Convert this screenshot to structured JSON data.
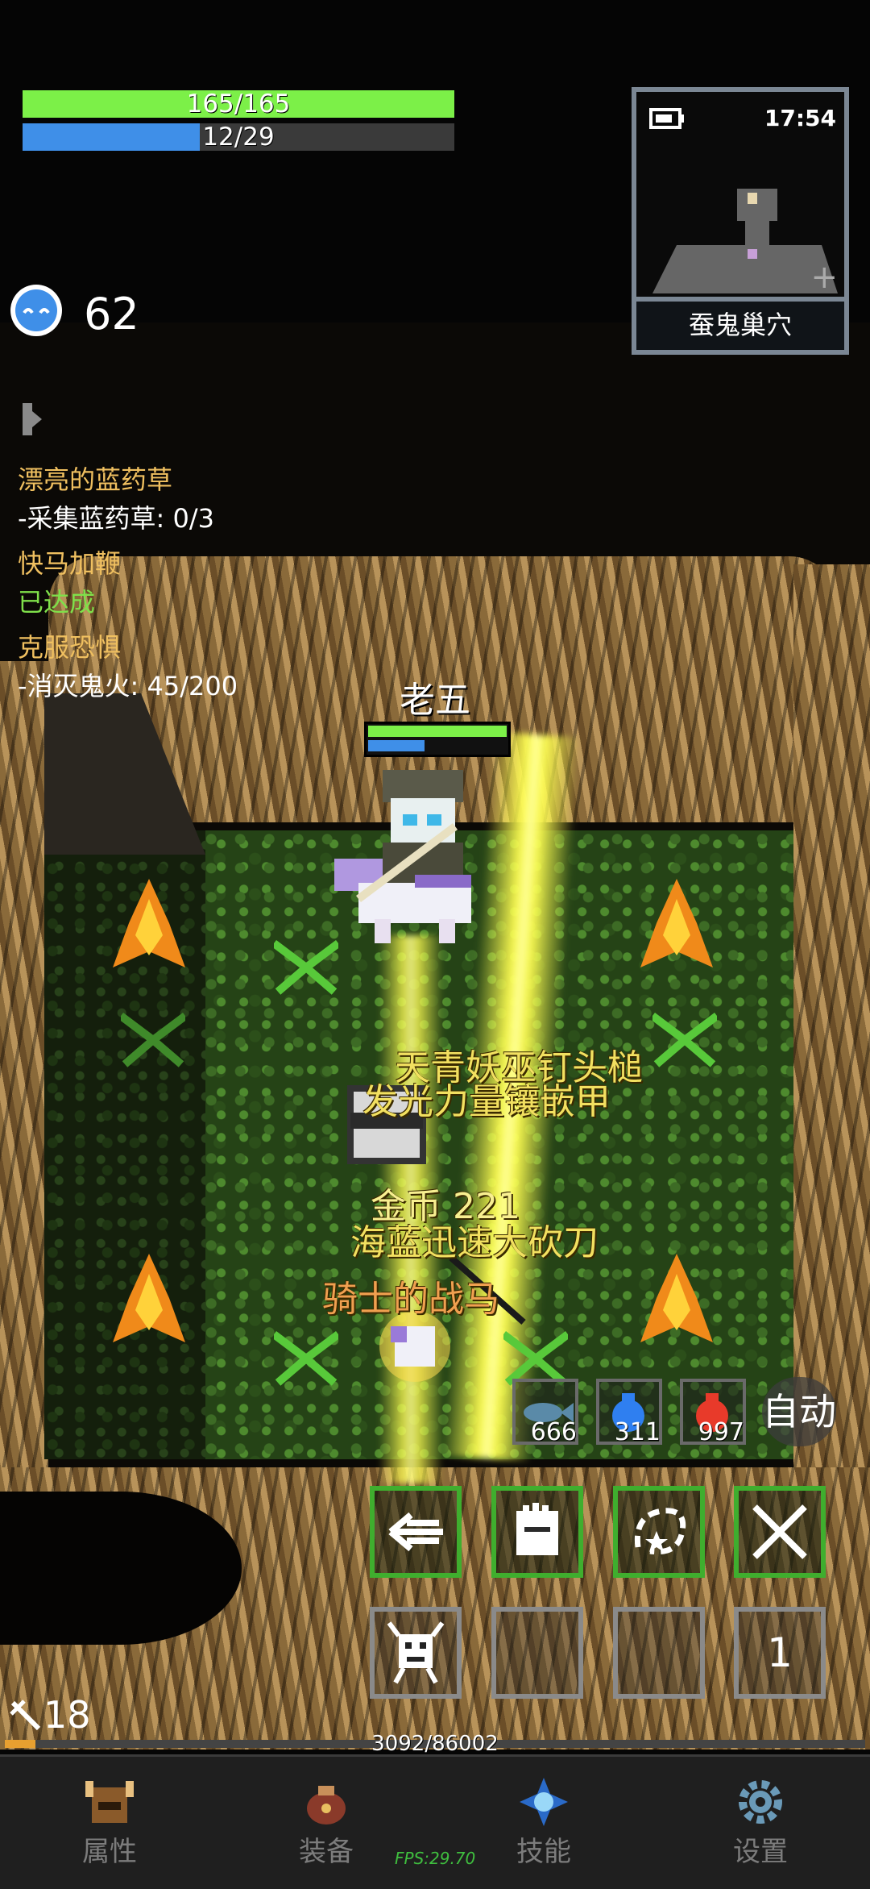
{
  "player": {
    "hp_text": "165/165",
    "hp_fraction": 1.0,
    "mp_text": "12/29",
    "mp_fraction": 0.41,
    "name": "老五",
    "level": "18",
    "exp_text": "3092/86002",
    "exp_fraction": 0.036
  },
  "currency": {
    "gem_count": "62",
    "icon": "blue-gem-icon"
  },
  "minimap": {
    "time": "17:54",
    "location": "蚕鬼巢穴"
  },
  "quests": [
    {
      "title": "漂亮的蓝药草",
      "detail": "-采集蓝药草: 0/3"
    },
    {
      "title": "快马加鞭",
      "detail": "已达成"
    },
    {
      "title": "克服恐惧",
      "detail": "-消灭鬼火: 45/200"
    }
  ],
  "drops": {
    "line1": "天青妖巫钉头槌",
    "line2": "发光力量镶嵌甲",
    "gold": "金币 221",
    "line3": "海蓝迅速大砍刀",
    "line4": "骑士的战马"
  },
  "potions": [
    {
      "icon": "fish-icon",
      "count": "666"
    },
    {
      "icon": "blue-potion-icon",
      "count": "311"
    },
    {
      "icon": "red-potion-icon",
      "count": "997"
    }
  ],
  "auto_label": "自动",
  "skill_slot_count": "1",
  "nav": [
    {
      "label": "属性",
      "icon": "helmet-icon"
    },
    {
      "label": "装备",
      "icon": "bag-icon"
    },
    {
      "label": "技能",
      "icon": "skill-orb-icon"
    },
    {
      "label": "设置",
      "icon": "gear-icon"
    }
  ],
  "fps": "FPS:29.70",
  "colors": {
    "hp": "#7cf048",
    "mp": "#3f8fe8",
    "exp": "#e8a030",
    "skill_border": "#3fae2e"
  }
}
